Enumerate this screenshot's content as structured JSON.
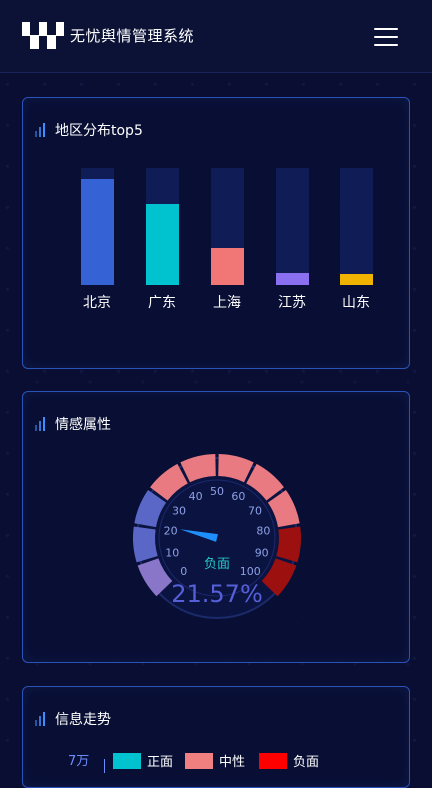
{
  "header": {
    "title": "无忧舆情管理系统",
    "menu_icon": "hamburger-menu-icon"
  },
  "region_panel": {
    "title": "地区分布top5",
    "bars": [
      {
        "label": "北京",
        "value": 0.91,
        "color": "#3563d6"
      },
      {
        "label": "广东",
        "value": 0.69,
        "color": "#00c3cf"
      },
      {
        "label": "上海",
        "value": 0.32,
        "color": "#f17676"
      },
      {
        "label": "江苏",
        "value": 0.1,
        "color": "#8a70f0"
      },
      {
        "label": "山东",
        "value": 0.09,
        "color": "#f0b400"
      }
    ]
  },
  "sentiment_panel": {
    "title": "情感属性",
    "gauge": {
      "ticks": [
        "0",
        "10",
        "20",
        "30",
        "40",
        "50",
        "60",
        "70",
        "80",
        "90",
        "100"
      ],
      "value": 21.57,
      "value_text": "21.57%",
      "label": "负面"
    }
  },
  "trend_panel": {
    "title": "信息走势",
    "y_top": "7万",
    "legend": [
      {
        "label": "正面",
        "color": "#00c3cf"
      },
      {
        "label": "中性",
        "color": "#f08080"
      },
      {
        "label": "负面",
        "color": "#ff0000"
      }
    ]
  }
}
